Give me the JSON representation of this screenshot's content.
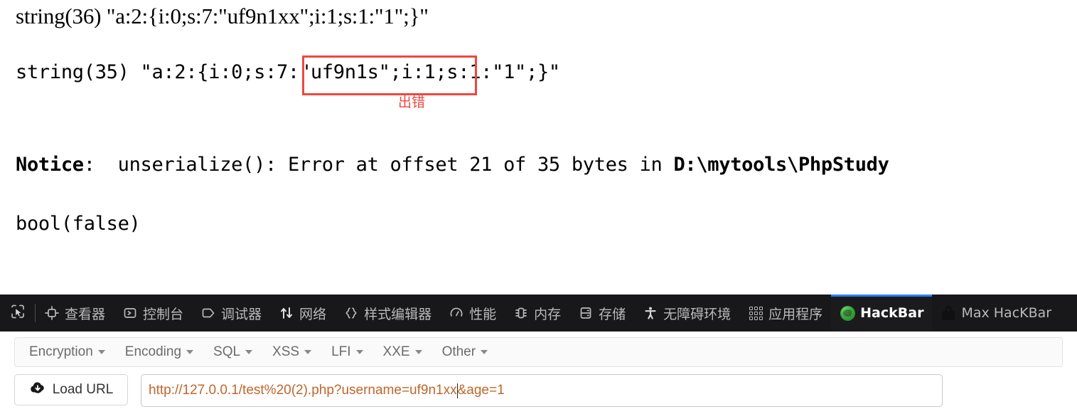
{
  "output": {
    "line1": "string(36) \"a:2:{i:0;s:7:\"uf9n1xx\";i:1;s:1:\"1\";}\"",
    "line2": "string(35) \"a:2:{i:0;s:7:\"uf9n1s\";i:1;s:1:\"1\";}\"",
    "annotation": "出错",
    "notice_label": "Notice",
    "notice_sep": ":  ",
    "notice_text": "unserialize(): Error at offset 21 of 35 bytes in ",
    "notice_path": "D:\\mytools\\PhpStudy",
    "bool_line": "bool(false)",
    "annotation_color": "#f0473f"
  },
  "devtools": {
    "picker_icon": "element-picker-icon",
    "accent_color": "#2f7ff5",
    "tabs": [
      {
        "label": "查看器",
        "icon": "inspector-icon",
        "active": false
      },
      {
        "label": "控制台",
        "icon": "console-icon",
        "active": false
      },
      {
        "label": "调试器",
        "icon": "debugger-icon",
        "active": false
      },
      {
        "label": "网络",
        "icon": "network-icon",
        "active": false
      },
      {
        "label": "样式编辑器",
        "icon": "style-editor-icon",
        "active": false
      },
      {
        "label": "性能",
        "icon": "performance-icon",
        "active": false
      },
      {
        "label": "内存",
        "icon": "memory-icon",
        "active": false
      },
      {
        "label": "存储",
        "icon": "storage-icon",
        "active": false
      },
      {
        "label": "无障碍环境",
        "icon": "accessibility-icon",
        "active": false
      },
      {
        "label": "应用程序",
        "icon": "application-grid-icon",
        "active": false
      },
      {
        "label": "HackBar",
        "icon": "hackbar-logo-icon",
        "active": true
      },
      {
        "label": "Max HacKBar",
        "icon": "padlock-icon",
        "active": false
      }
    ]
  },
  "hackbar": {
    "menu": [
      {
        "label": "Encryption"
      },
      {
        "label": "Encoding"
      },
      {
        "label": "SQL"
      },
      {
        "label": "XSS"
      },
      {
        "label": "LFI"
      },
      {
        "label": "XXE"
      },
      {
        "label": "Other"
      }
    ],
    "load_url_label": "Load URL",
    "load_url_icon": "cloud-download-icon",
    "url_before_caret": "http://127.0.0.1/test%20(2).php?username=uf9n1xx",
    "url_after_caret": "&age=1",
    "url_color": "#c0662a"
  }
}
